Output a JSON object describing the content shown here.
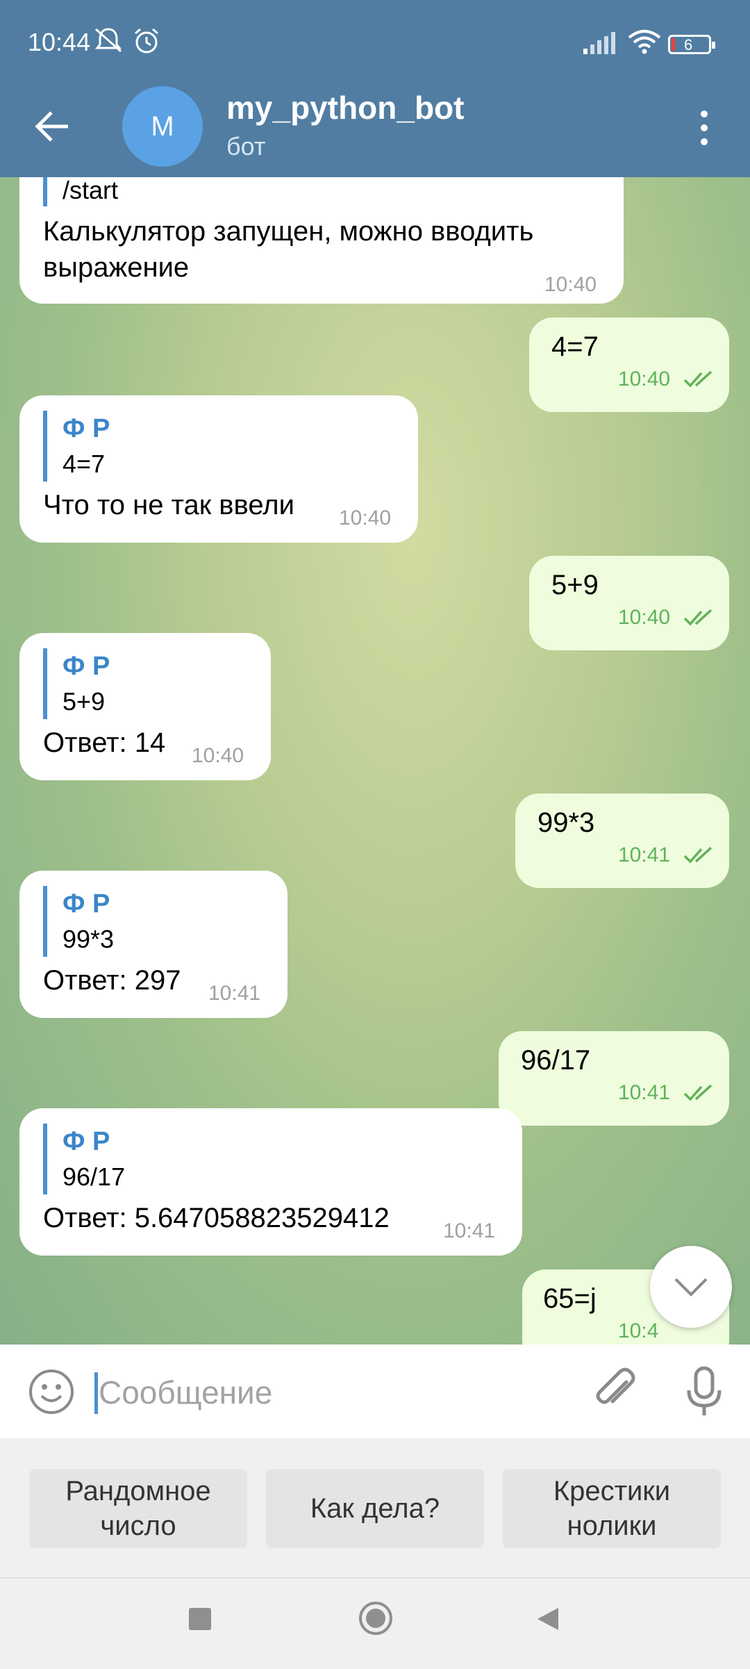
{
  "status_bar": {
    "time": "10:44",
    "battery": "6"
  },
  "header": {
    "avatar_letter": "M",
    "title": "my_python_bot",
    "subtitle": "бот"
  },
  "messages": [
    {
      "dir": "in",
      "quote_text": "/start",
      "text_line1": "Калькулятор запущен, можно вводить",
      "text_line2": "выражение",
      "time": "10:40"
    },
    {
      "dir": "out",
      "text": "4=7",
      "time": "10:40"
    },
    {
      "dir": "in",
      "quote_name": "Ф Р",
      "quote_text": "4=7",
      "text": "Что то не так ввели",
      "time": "10:40"
    },
    {
      "dir": "out",
      "text": "5+9",
      "time": "10:40"
    },
    {
      "dir": "in",
      "quote_name": "Ф Р",
      "quote_text": "5+9",
      "text": "Ответ: 14",
      "time": "10:40"
    },
    {
      "dir": "out",
      "text": "99*3",
      "time": "10:41"
    },
    {
      "dir": "in",
      "quote_name": "Ф Р",
      "quote_text": "99*3",
      "text": "Ответ: 297",
      "time": "10:41"
    },
    {
      "dir": "out",
      "text": "96/17",
      "time": "10:41"
    },
    {
      "dir": "in",
      "quote_name": "Ф Р",
      "quote_text": "96/17",
      "text": "Ответ: 5.647058823529412",
      "time": "10:41"
    },
    {
      "dir": "out",
      "text": "65=j",
      "time": "10:4"
    }
  ],
  "composer": {
    "placeholder": "Сообщение"
  },
  "keyboard": {
    "buttons": [
      {
        "line1": "Рандомное",
        "line2": "число"
      },
      {
        "line1": "Как дела?",
        "line2": ""
      },
      {
        "line1": "Крестики",
        "line2": "нолики"
      }
    ]
  },
  "colors": {
    "header": "#517da2",
    "outgoing": "#effdde",
    "incoming": "#ffffff",
    "accent": "#4a8fd3"
  },
  "icons": [
    "back-arrow-icon",
    "more-vertical-icon",
    "emoji-icon",
    "attach-icon",
    "mic-icon",
    "chevron-down-icon",
    "double-check-icon",
    "square-icon",
    "circle-icon",
    "triangle-back-icon"
  ]
}
